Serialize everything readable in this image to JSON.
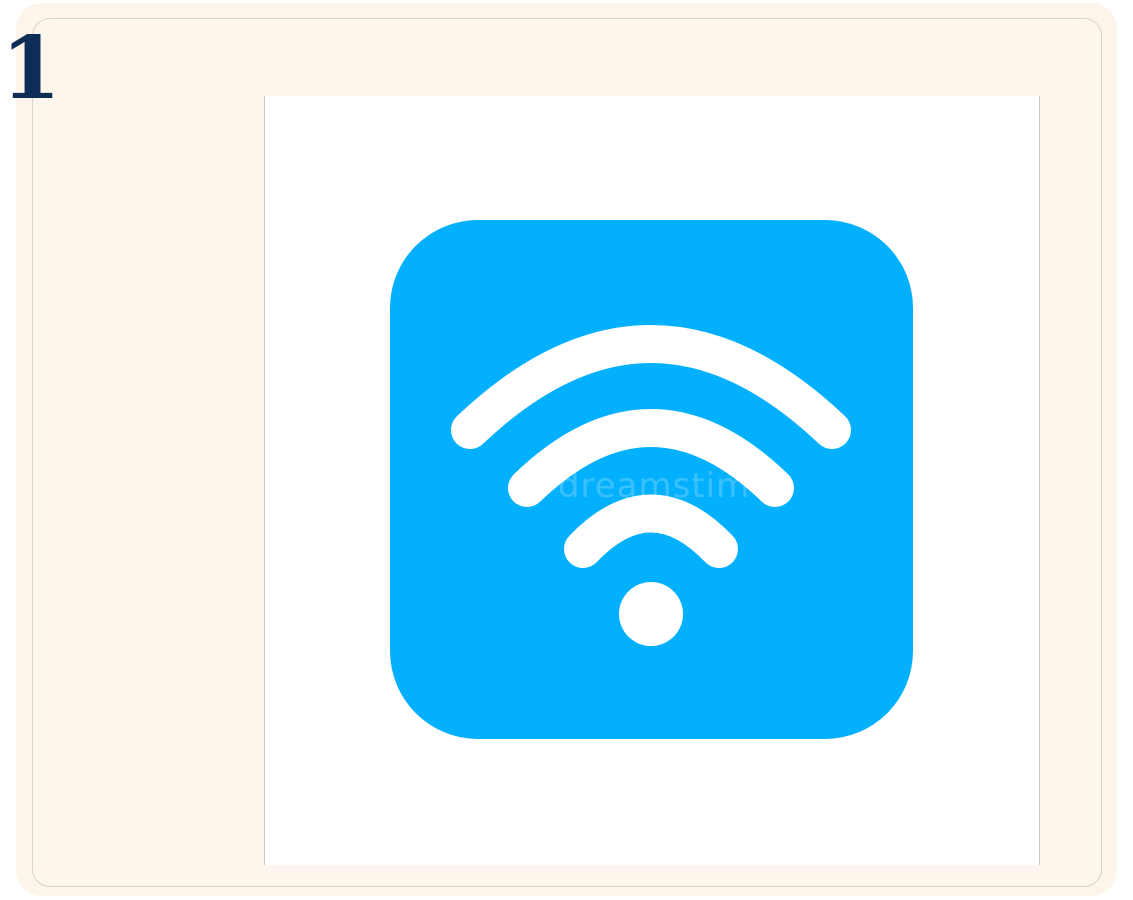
{
  "card": {
    "number": "1"
  },
  "image": {
    "icon": "wifi-icon",
    "icon_background_color": "#03b0fd",
    "icon_symbol_color": "#ffffff",
    "watermark_text": "dreamstime"
  },
  "colors": {
    "page_background": "#fdf6ed",
    "number_color": "#0d2d57"
  }
}
